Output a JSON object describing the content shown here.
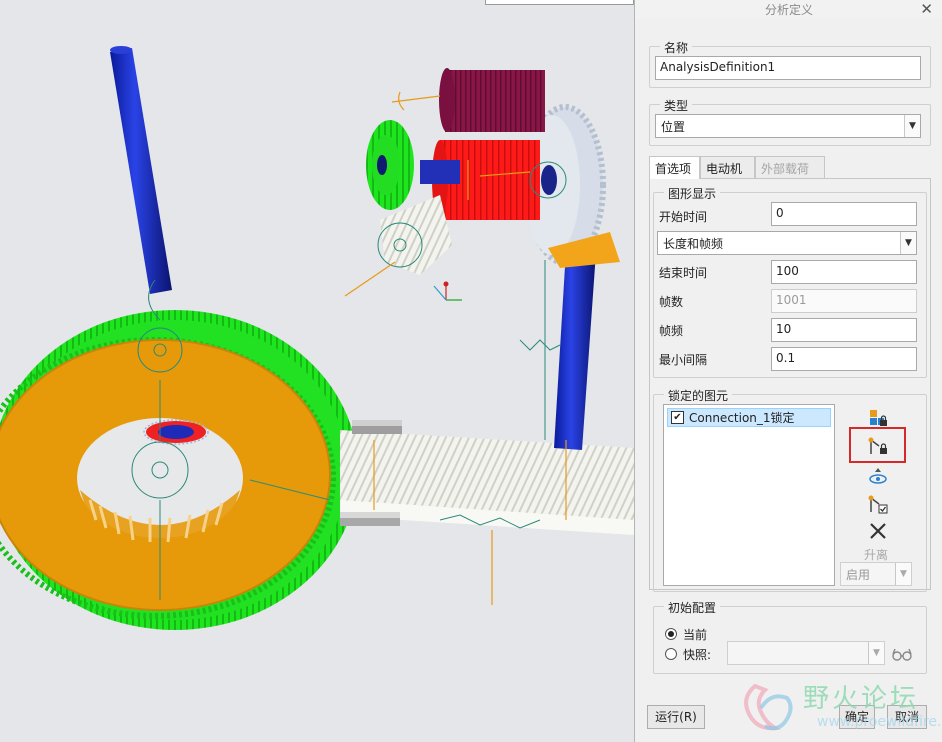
{
  "panel": {
    "title": "分析定义",
    "name_label": "名称",
    "name_value": "AnalysisDefinition1",
    "type_label": "类型",
    "type_value": "位置",
    "tabs": [
      {
        "label": "首选项",
        "state": "active"
      },
      {
        "label": "电动机",
        "state": "normal"
      },
      {
        "label": "外部载荷",
        "state": "disabled"
      }
    ],
    "graph_display": {
      "legend": "图形显示",
      "start_time_label": "开始时间",
      "start_time_value": "0",
      "mode_value": "长度和帧频",
      "end_time_label": "结束时间",
      "end_time_value": "100",
      "frames_label": "帧数",
      "frames_value": "1001",
      "frame_rate_label": "帧频",
      "frame_rate_value": "10",
      "min_interval_label": "最小间隔",
      "min_interval_value": "0.1"
    },
    "locked": {
      "legend": "锁定的图元",
      "items": [
        {
          "label": "Connection_1锁定",
          "checked": true
        }
      ],
      "separate_label": "升离",
      "enable_value": "启用"
    },
    "initial_config": {
      "legend": "初始配置",
      "current_label": "当前",
      "snapshot_label": "快照:",
      "snapshot_value": ""
    },
    "buttons": {
      "run": "运行(R)",
      "ok": "确定",
      "cancel": "取消"
    }
  },
  "watermark": {
    "text": "野火论坛",
    "url": "www.proewildfire.cn"
  }
}
